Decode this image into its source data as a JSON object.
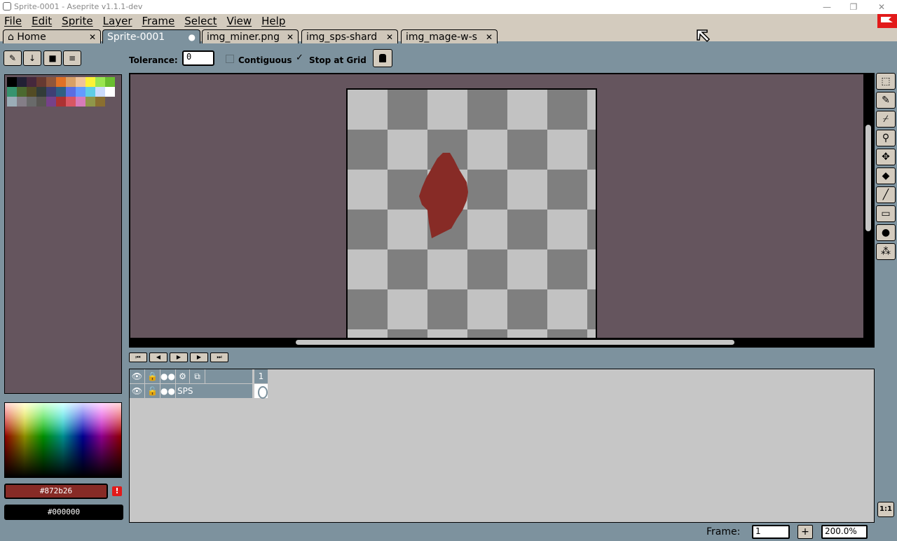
{
  "window": {
    "title": "Sprite-0001 - Aseprite v1.1.1-dev"
  },
  "menu": [
    "File",
    "Edit",
    "Sprite",
    "Layer",
    "Frame",
    "Select",
    "View",
    "Help"
  ],
  "tabs": [
    {
      "label": "Home",
      "icon": "home-icon",
      "active": false
    },
    {
      "label": "Sprite-0001",
      "active": true,
      "modified": true
    },
    {
      "label": "img_miner.png",
      "active": false
    },
    {
      "label": "img_sps-shard",
      "active": false
    },
    {
      "label": "img_mage-w-s",
      "active": false
    }
  ],
  "toolbar": {
    "tolerance_label": "Tolerance:",
    "tolerance_value": "0",
    "contiguous_label": "Contiguous",
    "contiguous_checked": false,
    "stop_at_grid_label": "Stop at Grid",
    "stop_at_grid_checked": true
  },
  "palette": [
    "#000000",
    "#222034",
    "#45283c",
    "#663931",
    "#8f563b",
    "#df7126",
    "#d9a066",
    "#eec39a",
    "#fbf236",
    "#99e550",
    "#6abe30",
    "#37946e",
    "#4b692f",
    "#524b24",
    "#323c39",
    "#3f3f74",
    "#306082",
    "#5b6ee1",
    "#639bff",
    "#5fcde4",
    "#cbdbfc",
    "#ffffff",
    "#9badb7",
    "#847e87",
    "#696a6a",
    "#595652",
    "#76428a",
    "#ac3232",
    "#d95763",
    "#d77bba",
    "#8f974a",
    "#8a6f30"
  ],
  "colors": {
    "foreground": "#872b26",
    "background": "#000000",
    "foreground_label": "#872b26",
    "background_label": "#000000",
    "accent": "#e21a1a"
  },
  "timeline": {
    "frame_number": "1",
    "layer_name": "SPS"
  },
  "status": {
    "frame_label": "Frame:",
    "frame_value": "1",
    "frame_add": "+",
    "zoom": "200.0%",
    "zoom_fit": "1:1"
  }
}
